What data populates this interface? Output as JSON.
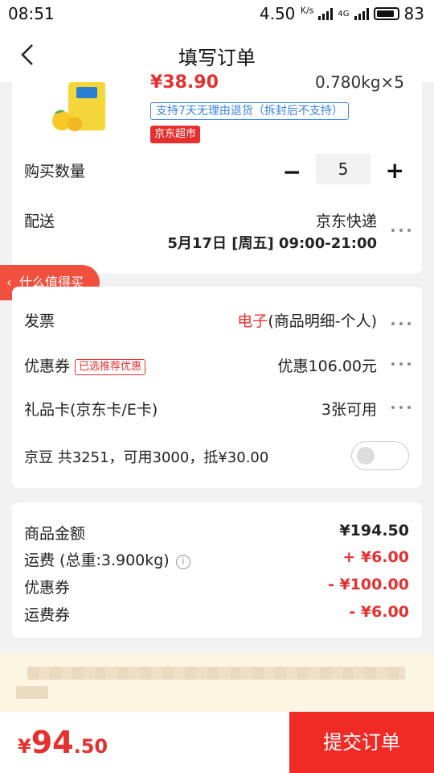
{
  "status_bar": {
    "time": "08:51",
    "speed": "4.50",
    "speed_unit": "K/s",
    "network": "4G",
    "battery": "83"
  },
  "header": {
    "title": "填写订单"
  },
  "product": {
    "price_partial": "¥38.90",
    "weight_partial": "0.780kg×5",
    "return_tag": "支持7天无理由退货（拆封后不支持）",
    "store_tag": "京东超市"
  },
  "quantity": {
    "label": "购买数量",
    "value": "5",
    "minus": "−",
    "plus": "+"
  },
  "delivery": {
    "label": "配送",
    "carrier": "京东快递",
    "time": "5月17日 [周五] 09:00-21:00"
  },
  "floating_tag": {
    "label": "什么值得买"
  },
  "invoice": {
    "label": "发票",
    "type": "电子",
    "detail": "(商品明细-个人)"
  },
  "coupon": {
    "label": "优惠券",
    "badge": "已选推荐优惠",
    "value": "优惠106.00元"
  },
  "gift_card": {
    "label": "礼品卡(京东卡/E卡)",
    "value": "3张可用"
  },
  "jingdou": {
    "label": "京豆 共3251，可用3000，抵¥30.00",
    "enabled": false
  },
  "summary": {
    "items": [
      {
        "label": "商品金额",
        "value": "¥194.50"
      },
      {
        "label": "运费 (总重:3.900kg)",
        "value": "+ ¥6.00"
      },
      {
        "label": "优惠券",
        "value": "- ¥100.00"
      },
      {
        "label": "运费券",
        "value": "- ¥6.00"
      }
    ]
  },
  "footer": {
    "currency": "¥",
    "total_int": "94",
    "total_dec": ".50",
    "submit_label": "提交订单"
  },
  "colors": {
    "accent": "#e5302f",
    "link_blue": "#3b82e0"
  }
}
